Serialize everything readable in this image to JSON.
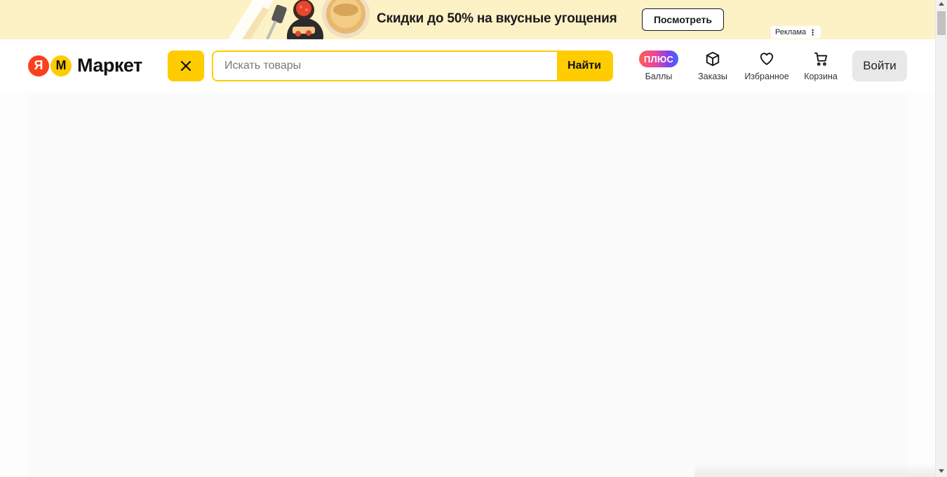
{
  "banner": {
    "text": "Скидки до 50% на вкусные угощения",
    "button_label": "Посмотреть",
    "ad_label": "Реклама",
    "ad_menu_icon": "⋮"
  },
  "header": {
    "logo": {
      "ya": "Я",
      "m": "М",
      "text": "Маркет"
    },
    "search": {
      "placeholder": "Искать товары",
      "value": "",
      "button_label": "Найти"
    },
    "nav": {
      "plus_badge": "ПЛЮС",
      "points_label": "Баллы",
      "orders_label": "Заказы",
      "favorites_label": "Избранное",
      "cart_label": "Корзина"
    },
    "login_label": "Войти"
  },
  "colors": {
    "brand_yellow": "#ffcc00",
    "logo_red": "#fc3f1d",
    "banner_bg": "#fdf1c6"
  }
}
